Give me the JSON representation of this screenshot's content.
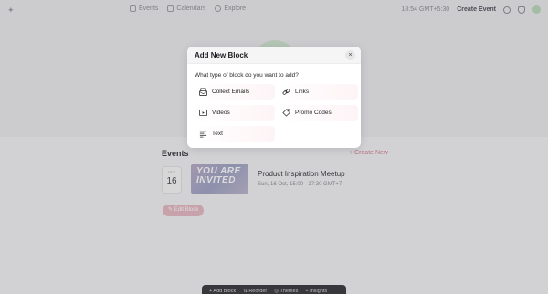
{
  "topbar": {
    "nav": [
      {
        "label": "Events",
        "icon": "ticket-icon"
      },
      {
        "label": "Calendars",
        "icon": "calendar-icon"
      },
      {
        "label": "Explore",
        "icon": "compass-icon"
      }
    ],
    "time": "18:54 GMT+5:30",
    "create_event": "Create Event"
  },
  "events_section": {
    "title": "Events",
    "create_new": "+ Create New",
    "event": {
      "month": "OCT",
      "day": "16",
      "thumb_text": "YOU ARE INVITED",
      "title": "Product Inspiration Meetup",
      "time": "Sun, 16 Oct, 15:00 - 17:30 GMT+7"
    },
    "edit_block": "✎ Edit Block"
  },
  "bottom_bar": {
    "items": [
      "+ Add Block",
      "⇅ Reorder",
      "◎ Themes",
      "⌁ Insights"
    ]
  },
  "modal": {
    "title": "Add New Block",
    "close": "×",
    "question": "What type of block do you want to add?",
    "options": [
      {
        "label": "Collect Emails",
        "icon": "collect-emails-icon"
      },
      {
        "label": "Links",
        "icon": "link-icon"
      },
      {
        "label": "Videos",
        "icon": "video-icon"
      },
      {
        "label": "Promo Codes",
        "icon": "tag-icon"
      },
      {
        "label": "Text",
        "icon": "text-icon"
      }
    ]
  },
  "colors": {
    "accent": "#d47a8a",
    "overlay": "#5a5a60"
  }
}
